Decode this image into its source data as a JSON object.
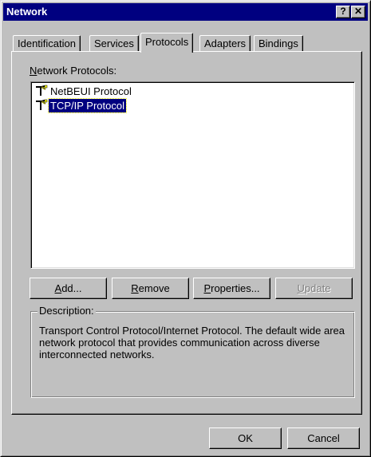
{
  "window": {
    "title": "Network",
    "help_label": "?",
    "close_label": "✕"
  },
  "tabs": [
    {
      "label": "Identification"
    },
    {
      "label": "Services"
    },
    {
      "label": "Protocols"
    },
    {
      "label": "Adapters"
    },
    {
      "label": "Bindings"
    }
  ],
  "protocols": {
    "label": "Network Protocols:",
    "items": [
      {
        "label": "NetBEUI Protocol",
        "icon": "network-protocol-icon"
      },
      {
        "label": "TCP/IP Protocol",
        "icon": "network-protocol-icon"
      }
    ]
  },
  "buttons": {
    "add": "Add...",
    "remove": "Remove",
    "properties": "Properties...",
    "update": "Update"
  },
  "description": {
    "title": "Description:",
    "text": "Transport Control Protocol/Internet Protocol. The default wide area network protocol that provides communication across diverse interconnected networks."
  },
  "footer": {
    "ok": "OK",
    "cancel": "Cancel"
  },
  "colors": {
    "title_bar": "#000080",
    "face": "#c0c0c0",
    "selection": "#000080"
  }
}
